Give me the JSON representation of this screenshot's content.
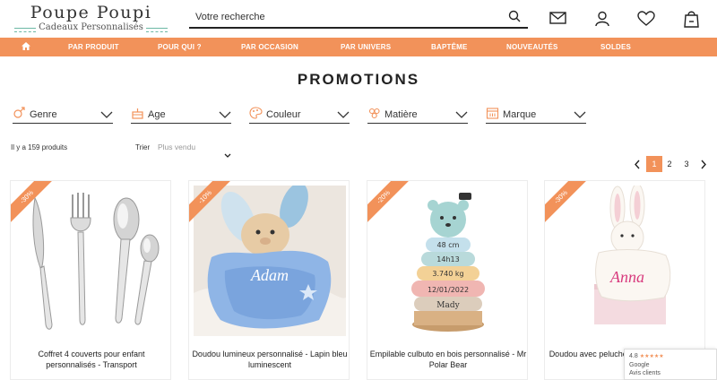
{
  "header": {
    "logo_title": "Poupe Poupi",
    "logo_subtitle": "Cadeaux Personnalisés",
    "search_placeholder": "Votre recherche"
  },
  "nav": [
    {
      "label": "",
      "icon": "home-icon"
    },
    {
      "label": "PAR PRODUIT"
    },
    {
      "label": "POUR QUI ?"
    },
    {
      "label": "PAR OCCASION"
    },
    {
      "label": "PAR UNIVERS"
    },
    {
      "label": "BAPTÊME"
    },
    {
      "label": "NOUVEAUTÉS"
    },
    {
      "label": "SOLDES"
    }
  ],
  "page": {
    "title": "PROMOTIONS"
  },
  "filters": [
    {
      "label": "Genre",
      "icon": "gender-icon"
    },
    {
      "label": "Age",
      "icon": "cake-icon"
    },
    {
      "label": "Couleur",
      "icon": "palette-icon"
    },
    {
      "label": "Matière",
      "icon": "material-icon"
    },
    {
      "label": "Marque",
      "icon": "calendar-icon"
    }
  ],
  "listing": {
    "count_text": "Il y a 159 produits",
    "sort_label": "Trier",
    "sort_value": "Plus vendu"
  },
  "pagination": {
    "current": "1",
    "pages": [
      "1",
      "2",
      "3"
    ]
  },
  "products": [
    {
      "discount": "-30%",
      "name": "Coffret 4 couverts pour enfant personnalisés - Transport"
    },
    {
      "discount": "-10%",
      "name": "Doudou lumineux personnalisé - Lapin bleu luminescent"
    },
    {
      "discount": "-20%",
      "name": "Empilable culbuto en bois personnalisé - Mr Polar Bear"
    },
    {
      "discount": "-30%",
      "name": "Doudou avec peluche personnalisé - Lapin"
    }
  ],
  "product_prints": {
    "doudou_name": "Adam",
    "stack_rings": [
      "48 cm",
      "14h13",
      "3.740 kg",
      "12/01/2022",
      "Mady"
    ],
    "rabbit_name": "Anna"
  },
  "google_badge": {
    "rating": "4.8",
    "brand": "Google",
    "label": "Avis clients"
  },
  "colors": {
    "accent": "#f2925a",
    "text": "#222222"
  }
}
